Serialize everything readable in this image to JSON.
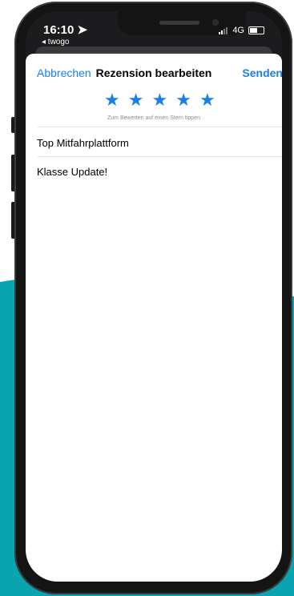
{
  "status_bar": {
    "time": "16:10 ➤",
    "back_app": "◂ twogo",
    "network": "4G"
  },
  "nav": {
    "cancel_label": "Abbrechen",
    "title": "Rezension bearbeiten",
    "send_label": "Senden"
  },
  "rating": {
    "value": 5,
    "max": 5,
    "hint": "Zum Bewerten auf einen Stern tippen"
  },
  "review": {
    "title": "Top Mitfahrplattform",
    "body": "Klasse Update!"
  },
  "colors": {
    "accent": "#1a7fe8",
    "teal_background": "#0aa3b0"
  }
}
